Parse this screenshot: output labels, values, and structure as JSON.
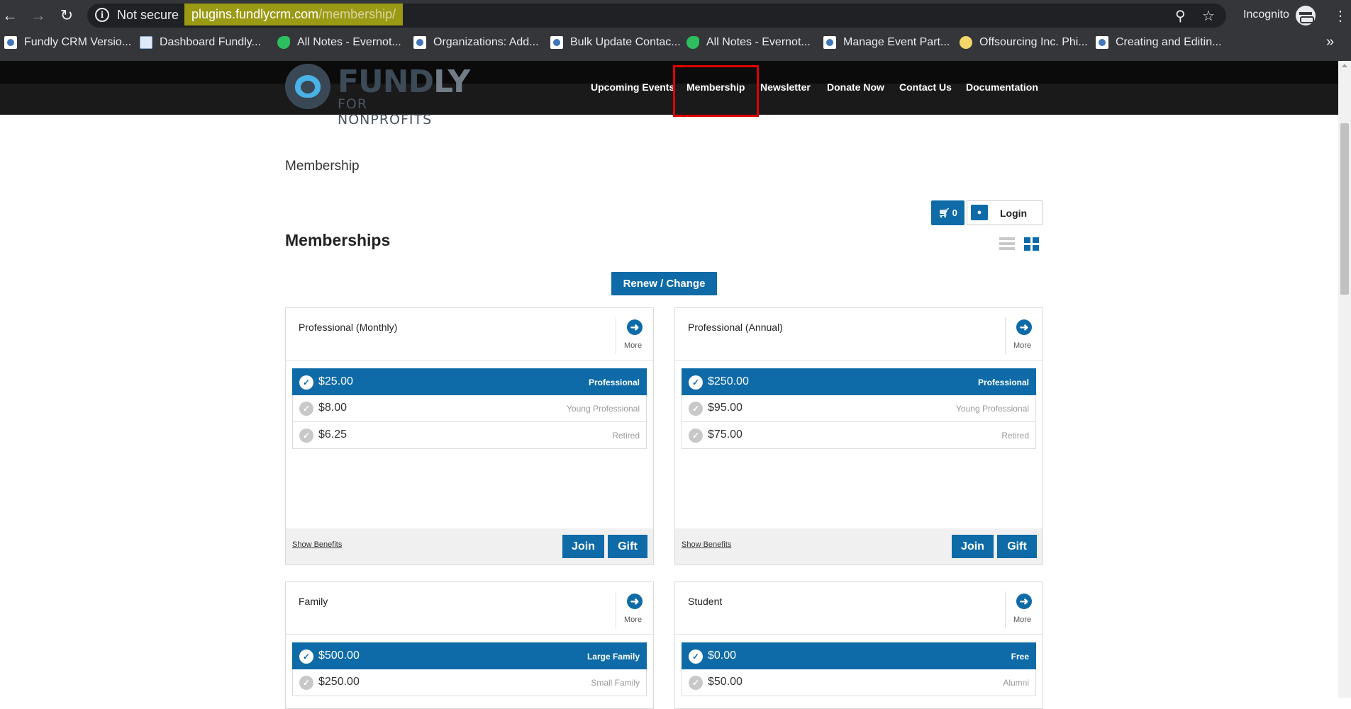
{
  "browser": {
    "security_label": "Not secure",
    "url_host": "plugins.fundlycrm.com",
    "url_path": "/membership/",
    "incognito_label": "Incognito",
    "bookmarks": [
      {
        "label": "Fundly CRM Versio...",
        "icon": "fundly-favicon"
      },
      {
        "label": "Dashboard Fundly...",
        "icon": "doc-favicon"
      },
      {
        "label": "All Notes - Evernot...",
        "icon": "evernote-favicon"
      },
      {
        "label": "Organizations: Add...",
        "icon": "fundly-favicon"
      },
      {
        "label": "Bulk Update Contac...",
        "icon": "fundly-favicon"
      },
      {
        "label": "All Notes - Evernot...",
        "icon": "evernote-favicon"
      },
      {
        "label": "Manage Event Part...",
        "icon": "fundly-favicon"
      },
      {
        "label": "Offsourcing Inc. Phi...",
        "icon": "stack-favicon"
      },
      {
        "label": "Creating and Editin...",
        "icon": "fundly-favicon"
      }
    ],
    "more_bookmarks": "»"
  },
  "site": {
    "logo_text_main": "FUND",
    "logo_text_accent": "LY",
    "logo_subtext": "FOR NONPROFITS",
    "nav": [
      "Upcoming Events",
      "Membership",
      "Newsletter",
      "Donate Now",
      "Contact Us",
      "Documentation"
    ],
    "active_nav": "Membership",
    "highlight_color": "#e00000"
  },
  "page": {
    "title": "Membership",
    "cart_count": "0",
    "login_label": "Login",
    "section_title": "Memberships",
    "renew_label": "Renew / Change",
    "accent_color": "#0e6ba8"
  },
  "cards": [
    {
      "title": "Professional (Monthly)",
      "more_label": "More",
      "prices": [
        {
          "amount": "$25.00",
          "tier": "Professional",
          "selected": true
        },
        {
          "amount": "$8.00",
          "tier": "Young Professional",
          "selected": false
        },
        {
          "amount": "$6.25",
          "tier": "Retired",
          "selected": false
        }
      ],
      "show_benefits": "Show Benefits",
      "join_label": "Join",
      "gift_label": "Gift"
    },
    {
      "title": "Professional (Annual)",
      "more_label": "More",
      "prices": [
        {
          "amount": "$250.00",
          "tier": "Professional",
          "selected": true
        },
        {
          "amount": "$95.00",
          "tier": "Young Professional",
          "selected": false
        },
        {
          "amount": "$75.00",
          "tier": "Retired",
          "selected": false
        }
      ],
      "show_benefits": "Show Benefits",
      "join_label": "Join",
      "gift_label": "Gift"
    },
    {
      "title": "Family",
      "more_label": "More",
      "prices": [
        {
          "amount": "$500.00",
          "tier": "Large Family",
          "selected": true
        },
        {
          "amount": "$250.00",
          "tier": "Small Family",
          "selected": false
        }
      ]
    },
    {
      "title": "Student",
      "more_label": "More",
      "prices": [
        {
          "amount": "$0.00",
          "tier": "Free",
          "selected": true
        },
        {
          "amount": "$50.00",
          "tier": "Alumni",
          "selected": false
        }
      ]
    }
  ]
}
